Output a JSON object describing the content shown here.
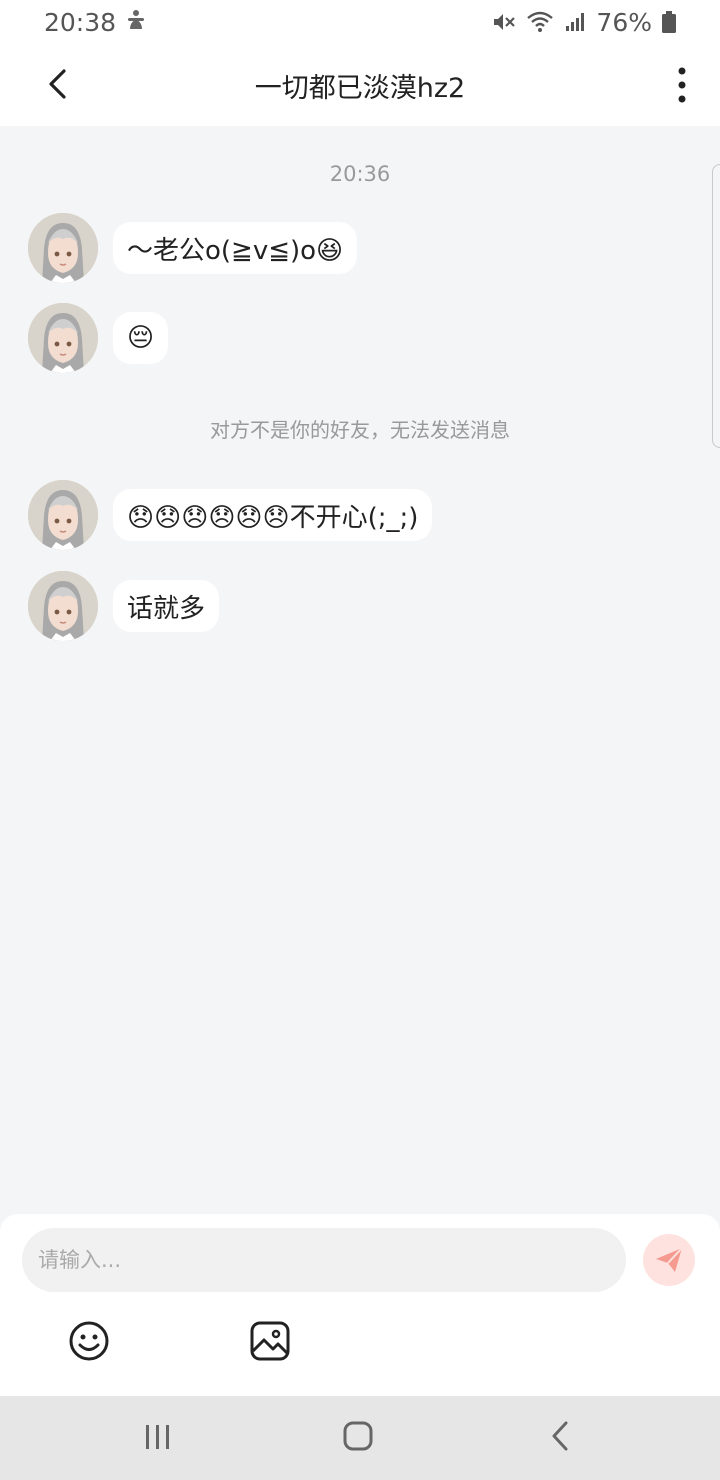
{
  "status_bar": {
    "time": "20:38",
    "battery": "76%",
    "icons": [
      "accessibility-icon",
      "mute-icon",
      "wifi-icon",
      "signal-icon",
      "battery-icon"
    ]
  },
  "header": {
    "title": "一切都已淡漠hz2",
    "back_icon": "chevron-left-icon",
    "more_icon": "more-vertical-icon"
  },
  "chat": {
    "timestamp": "20:36",
    "messages": [
      {
        "text": "～老公o(≧v≦)o😆"
      },
      {
        "text": "😔"
      },
      {
        "text": "😞😞😞😞😞😞不开心(;_;)"
      },
      {
        "text": "话就多"
      }
    ],
    "system_note": "对方不是你的好友，无法发送消息"
  },
  "input": {
    "placeholder": "请输入..."
  },
  "colors": {
    "background": "#f4f5f7",
    "bubble": "#ffffff",
    "send_button": "#fde2df",
    "send_icon": "#f59a8f"
  }
}
